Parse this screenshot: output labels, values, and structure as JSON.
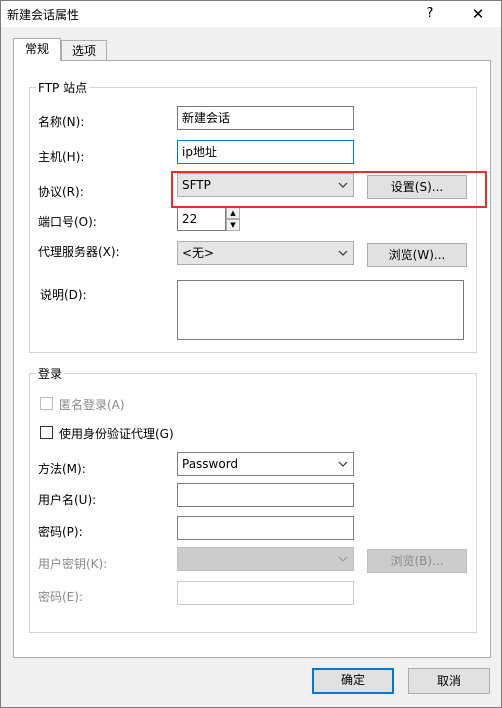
{
  "window": {
    "title": "新建会话属性",
    "help": "?",
    "close": "✕"
  },
  "tabs": [
    {
      "label": "常规"
    },
    {
      "label": "选项"
    }
  ],
  "ftp_group": {
    "title": "FTP 站点",
    "name_label": "名称(N):",
    "name_value": "新建会话",
    "host_label": "主机(H):",
    "host_value": "ip地址",
    "protocol_label": "协议(R):",
    "protocol_value": "SFTP",
    "settings_button": "设置(S)...",
    "port_label": "端口号(O):",
    "port_value": "22",
    "proxy_label": "代理服务器(X):",
    "proxy_value": "<无>",
    "browse_button": "浏览(W)...",
    "description_label": "说明(D):"
  },
  "login_group": {
    "title": "登录",
    "anonymous_label": "匿名登录(A)",
    "use_agent_label": "使用身份验证代理(G)",
    "method_label": "方法(M):",
    "method_value": "Password",
    "username_label": "用户名(U):",
    "password_label": "密码(P):",
    "user_key_label": "用户密钥(K):",
    "browse_key_button": "浏览(B)...",
    "passphrase_label": "密码(E):"
  },
  "footer": {
    "ok": "确定",
    "cancel": "取消"
  },
  "colors": {
    "highlight": "#e03030",
    "accent": "#0078d7"
  }
}
